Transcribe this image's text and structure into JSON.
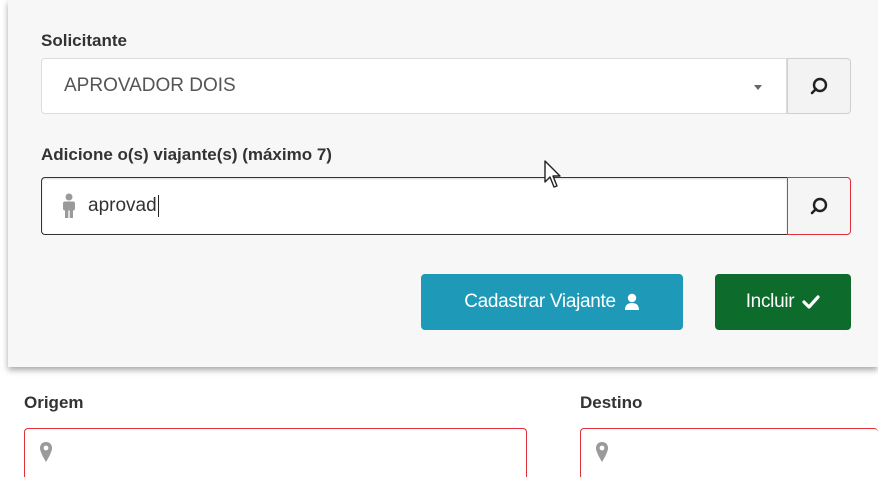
{
  "requester": {
    "label": "Solicitante",
    "selected_value": "APROVADOR DOIS",
    "search_icon": "search-icon",
    "dropdown_icon": "caret-down-icon"
  },
  "travelers": {
    "label": "Adicione o(s) viajante(s) (máximo 7)",
    "input_value": "aprovad",
    "person_icon": "person-icon",
    "search_icon": "search-icon",
    "search_border_color": "#e0303a"
  },
  "actions": {
    "register_traveler_label": "Cadastrar Viajante",
    "register_traveler_icon": "user-icon",
    "include_label": "Incluir",
    "include_icon": "check-icon",
    "register_color": "#1e9ab8",
    "include_color": "#0d6b2c"
  },
  "route": {
    "origin_label": "Origem",
    "destination_label": "Destino",
    "location_icon": "map-marker-icon",
    "error_border_color": "#e0303a"
  }
}
